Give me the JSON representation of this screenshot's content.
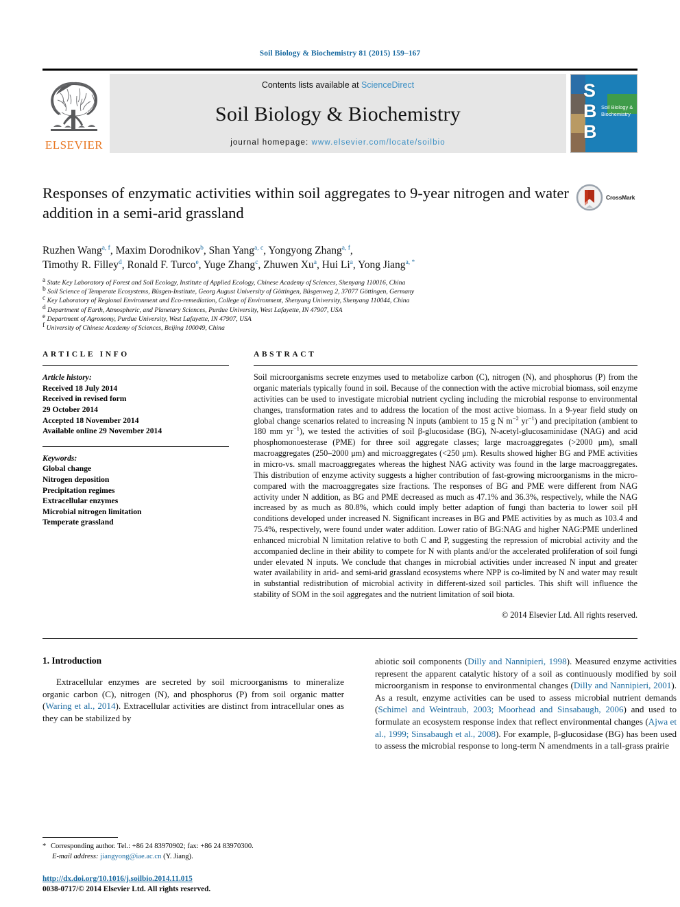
{
  "running_head": "Soil Biology & Biochemistry 81 (2015) 159–167",
  "masthead": {
    "publisher_wordmark": "ELSEVIER",
    "contents_prefix": "Contents lists available at ",
    "contents_link": "ScienceDirect",
    "journal_title": "Soil Biology & Biochemistry",
    "homepage_prefix": "journal homepage: ",
    "homepage_url": "www.elsevier.com/locate/soilbio",
    "cover": {
      "letters": [
        "S",
        "B",
        "B"
      ],
      "name_line1": "Soil Biology &",
      "name_line2": "Biochemistry"
    },
    "link_color": "#3b8fc4",
    "panel_bg": "#e6e6e6"
  },
  "article": {
    "title": "Responses of enzymatic activities within soil aggregates to 9-year nitrogen and water addition in a semi-arid grassland",
    "crossmark_label": "CrossMark",
    "authors_line1": [
      {
        "name": "Ruzhen Wang",
        "marks": "a, f",
        "sep": ", "
      },
      {
        "name": "Maxim Dorodnikov",
        "marks": "b",
        "sep": ", "
      },
      {
        "name": "Shan Yang",
        "marks": "a, c",
        "sep": ", "
      },
      {
        "name": "Yongyong Zhang",
        "marks": "a, f",
        "sep": ","
      }
    ],
    "authors_line2": [
      {
        "name": "Timothy R. Filley",
        "marks": "d",
        "sep": ", "
      },
      {
        "name": "Ronald F. Turco",
        "marks": "e",
        "sep": ", "
      },
      {
        "name": "Yuge Zhang",
        "marks": "c",
        "sep": ", "
      },
      {
        "name": "Zhuwen Xu",
        "marks": "a",
        "sep": ", "
      },
      {
        "name": "Hui Li",
        "marks": "a",
        "sep": ", "
      },
      {
        "name": "Yong Jiang",
        "marks": "a, *",
        "sep": ""
      }
    ],
    "affiliations": [
      {
        "mark": "a",
        "text": "State Key Laboratory of Forest and Soil Ecology, Institute of Applied Ecology, Chinese Academy of Sciences, Shenyang 110016, China"
      },
      {
        "mark": "b",
        "text": "Soil Science of Temperate Ecosystems, Büsgen-Institute, Georg August University of Göttingen, Büsgenweg 2, 37077 Göttingen, Germany"
      },
      {
        "mark": "c",
        "text": "Key Laboratory of Regional Environment and Eco-remediation, College of Environment, Shenyang University, Shenyang 110044, China"
      },
      {
        "mark": "d",
        "text": "Department of Earth, Atmospheric, and Planetary Sciences, Purdue University, West Lafayette, IN 47907, USA"
      },
      {
        "mark": "e",
        "text": "Department of Agronomy, Purdue University, West Lafayette, IN 47907, USA"
      },
      {
        "mark": "f",
        "text": "University of Chinese Academy of Sciences, Beijing 100049, China"
      }
    ]
  },
  "article_info": {
    "heading": "ARTICLE INFO",
    "history_label": "Article history:",
    "history": [
      "Received 18 July 2014",
      "Received in revised form",
      "29 October 2014",
      "Accepted 18 November 2014",
      "Available online 29 November 2014"
    ],
    "keywords_label": "Keywords:",
    "keywords": [
      "Global change",
      "Nitrogen deposition",
      "Precipitation regimes",
      "Extracellular enzymes",
      "Microbial nitrogen limitation",
      "Temperate grassland"
    ]
  },
  "abstract": {
    "heading": "ABSTRACT",
    "text_part1": "Soil microorganisms secrete enzymes used to metabolize carbon (C), nitrogen (N), and phosphorus (P) from the organic materials typically found in soil. Because of the connection with the active microbial biomass, soil enzyme activities can be used to investigate microbial nutrient cycling including the microbial response to environmental changes, transformation rates and to address the location of the most active biomass. In a 9-year field study on global change scenarios related to increasing N inputs (ambient to 15 g N m",
    "sup1": "−2",
    "text_mid1": " yr",
    "sup2": "−1",
    "text_mid2": ") and precipitation (ambient to 180 mm yr",
    "sup3": "−1",
    "text_part2": "), we tested the activities of soil β-glucosidase (BG), N-acetyl-glucosaminidase (NAG) and acid phosphomonoesterase (PME) for three soil aggregate classes; large macroaggregates (>2000 μm), small macroaggregates (250–2000 μm) and microaggregates (<250 μm). Results showed higher BG and PME activities in micro-vs. small macroaggregates whereas the highest NAG activity was found in the large macroaggregates. This distribution of enzyme activity suggests a higher contribution of fast-growing microorganisms in the micro-compared with the macroaggregates size fractions. The responses of BG and PME were different from NAG activity under N addition, as BG and PME decreased as much as 47.1% and 36.3%, respectively, while the NAG increased by as much as 80.8%, which could imply better adaption of fungi than bacteria to lower soil pH conditions developed under increased N. Significant increases in BG and PME activities by as much as 103.4 and 75.4%, respectively, were found under water addition. Lower ratio of BG:NAG and higher NAG:PME underlined enhanced microbial N limitation relative to both C and P, suggesting the repression of microbial activity and the accompanied decline in their ability to compete for N with plants and/or the accelerated proliferation of soil fungi under elevated N inputs. We conclude that changes in microbial activities under increased N input and greater water availability in arid- and semi-arid grassland ecosystems where NPP is co-limited by N and water may result in substantial redistribution of microbial activity in different-sized soil particles. This shift will influence the stability of SOM in the soil aggregates and the nutrient limitation of soil biota.",
    "copyright": "© 2014 Elsevier Ltd. All rights reserved."
  },
  "introduction": {
    "heading": "1. Introduction",
    "left_paragraph_a": "Extracellular enzymes are secreted by soil microorganisms to mineralize organic carbon (C), nitrogen (N), and phosphorus (P) from soil organic matter (",
    "left_ref_a": "Waring et al., 2014",
    "left_paragraph_b": "). Extracellular activities are distinct from intracellular ones as they can be stabilized by",
    "right_p1a": "abiotic soil components (",
    "right_ref1": "Dilly and Nannipieri, 1998",
    "right_p1b": "). Measured enzyme activities represent the apparent catalytic history of a soil as continuously modified by soil microorganism in response to environmental changes (",
    "right_ref2": "Dilly and Nannipieri, 2001",
    "right_p1c": "). As a result, enzyme activities can be used to assess microbial nutrient demands (",
    "right_ref3": "Schimel and Weintraub, 2003; Moorhead and Sinsabaugh, 2006",
    "right_p1d": ") and used to formulate an ecosystem response index that reflect environmental changes (",
    "right_ref4": "Ajwa et al., 1999; Sinsabaugh et al., 2008",
    "right_p1e": "). For example, β-glucosidase (BG) has been used to assess the microbial response to long-term N amendments in a tall-grass prairie"
  },
  "footer": {
    "corresponding_star": "*",
    "corresponding_text": "Corresponding author. Tel.: +86 24 83970902; fax: +86 24 83970300.",
    "email_label": "E-mail address:",
    "email": "jiangyong@iae.ac.cn",
    "email_owner": "(Y. Jiang).",
    "doi": "http://dx.doi.org/10.1016/j.soilbio.2014.11.015",
    "issn": "0038-0717/© 2014 Elsevier Ltd. All rights reserved."
  },
  "colors": {
    "link": "#1a6aa0",
    "cover_blue": "#1b7fb8",
    "elsevier_orange": "#e87722"
  }
}
